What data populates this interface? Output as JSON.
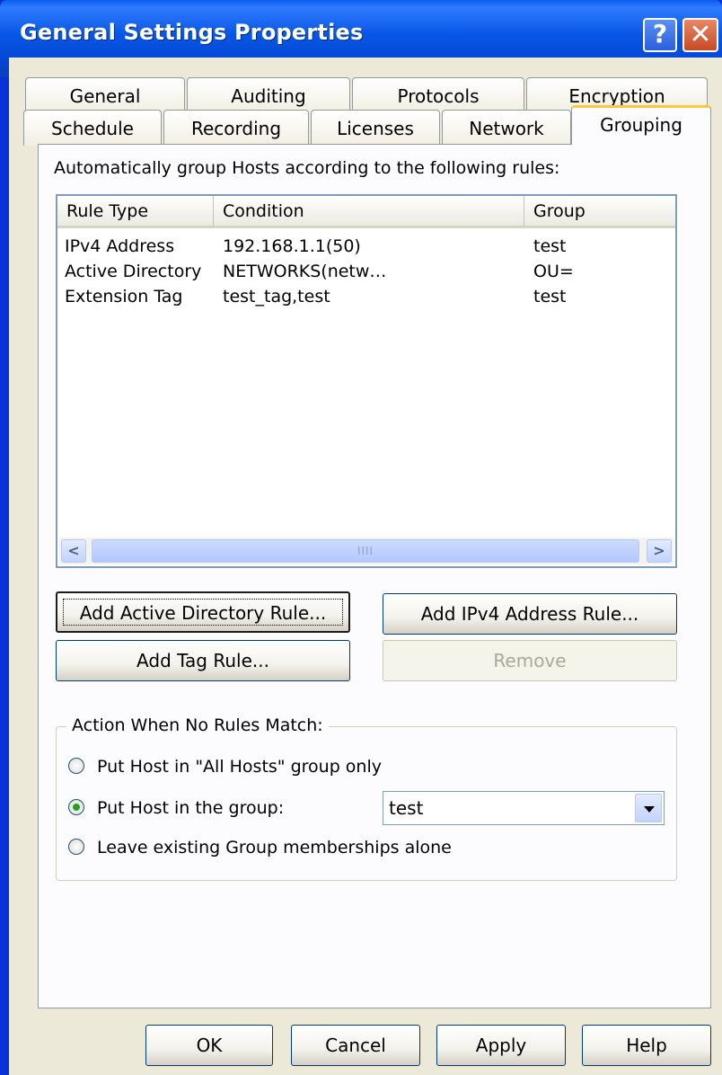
{
  "window": {
    "title": "General Settings Properties",
    "help_glyph": "?",
    "close_glyph": "✕"
  },
  "tabs_back": [
    "General",
    "Auditing",
    "Protocols",
    "Encryption"
  ],
  "tabs_front": [
    "Schedule",
    "Recording",
    "Licenses",
    "Network",
    "Grouping"
  ],
  "active_tab": "Grouping",
  "grouping": {
    "instruction": "Automatically group Hosts according to the following rules:",
    "columns": [
      "Rule Type",
      "Condition",
      "Group"
    ],
    "rows": [
      [
        "IPv4 Address",
        "192.168.1.1(50)",
        "test"
      ],
      [
        "Active Directory",
        "NETWORKS(netw…",
        "OU="
      ],
      [
        "Extension Tag",
        "test_tag,test",
        "test"
      ]
    ],
    "scroll_left_glyph": "<",
    "scroll_right_glyph": ">",
    "scroll_grip": "IIII",
    "buttons": {
      "add_ad": "Add Active Directory Rule...",
      "add_ipv4": "Add IPv4 Address Rule...",
      "add_tag": "Add Tag Rule...",
      "remove": "Remove"
    },
    "no_match": {
      "legend": "Action When No Rules Match:",
      "options": [
        "Put Host in \"All Hosts\" group only",
        "Put Host in the group:",
        "Leave existing Group memberships alone"
      ],
      "selected_index": 1,
      "group_value": "test"
    }
  },
  "footer": {
    "ok": "OK",
    "cancel": "Cancel",
    "apply": "Apply",
    "help": "Help"
  }
}
